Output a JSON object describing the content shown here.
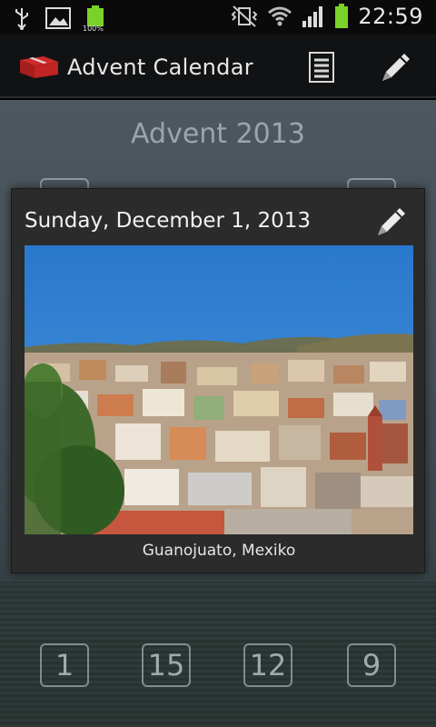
{
  "status_bar": {
    "battery_small_label": "100%",
    "time": "22:59"
  },
  "action_bar": {
    "title": "Advent Calendar",
    "icons": [
      "app-gift-icon",
      "list-icon",
      "pencil-icon"
    ]
  },
  "calendar": {
    "title": "Advent 2013",
    "visible_numbers_bottom_row": [
      "1",
      "15",
      "12",
      "9"
    ]
  },
  "dialog": {
    "date": "Sunday, December 1, 2013",
    "caption": "Guanojuato, Mexiko",
    "edit_icon": "pencil-icon"
  },
  "colors": {
    "action_bar_bg": "#111214",
    "dialog_bg": "#2b2b2c",
    "sky": "#2d7fd0",
    "battery_green": "#7bd12a"
  }
}
